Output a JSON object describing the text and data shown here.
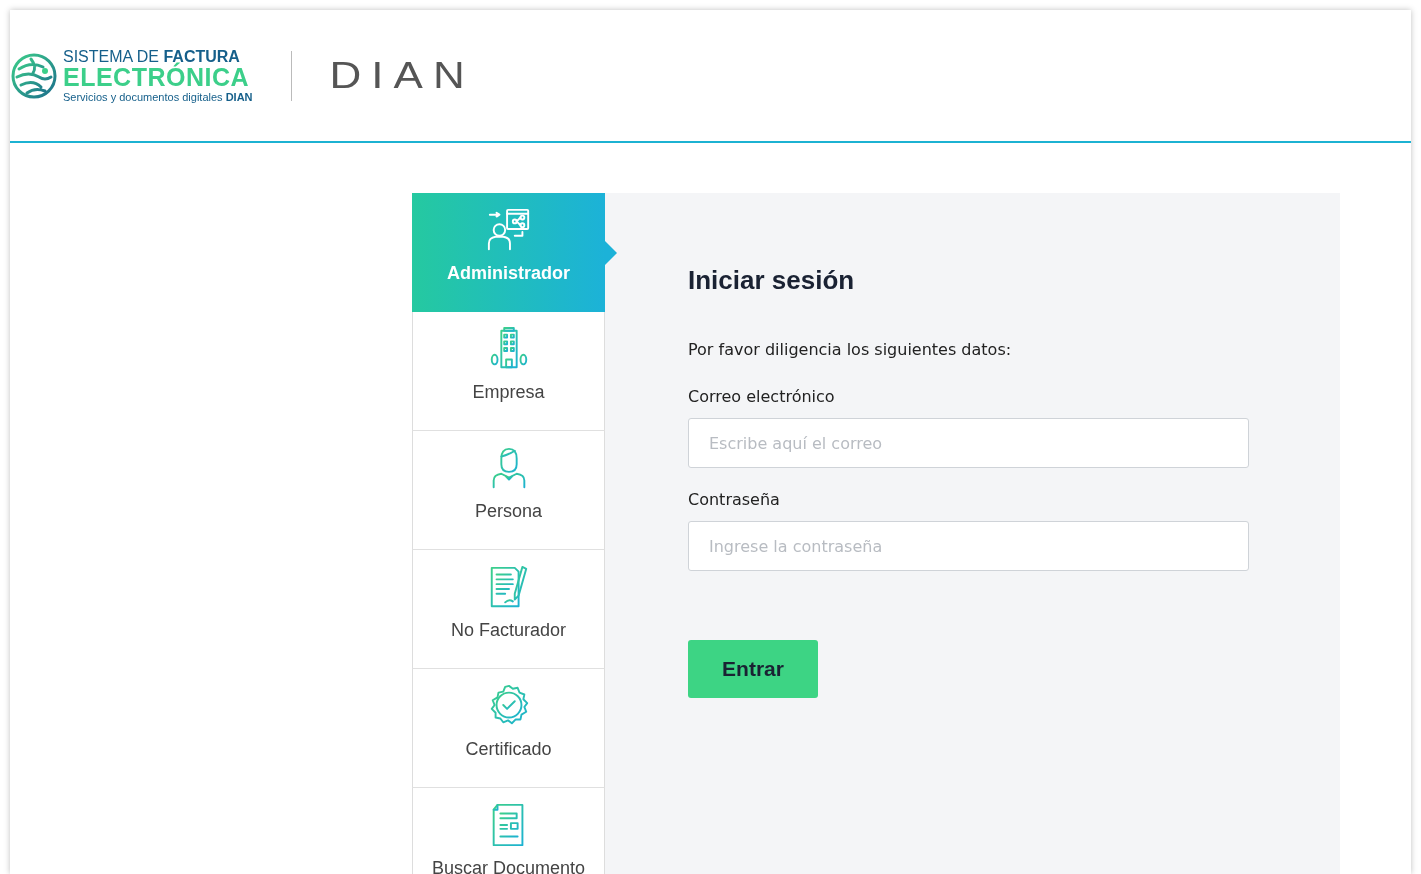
{
  "header": {
    "logo_line1": "SISTEMA DE **FACTURA**",
    "logo_line2": "ELECTRÓNICA",
    "logo_line3": "Servicios y documentos digitales **DIAN**",
    "brand": "DIAN"
  },
  "tabs": [
    {
      "label": "Administrador",
      "kind": "admin",
      "selected": true
    },
    {
      "label": "Empresa",
      "kind": "building",
      "selected": false
    },
    {
      "label": "Persona",
      "kind": "person",
      "selected": false
    },
    {
      "label": "No Facturador",
      "kind": "document-pen",
      "selected": false
    },
    {
      "label": "Certificado",
      "kind": "certificate",
      "selected": false
    },
    {
      "label": "Buscar Documento",
      "kind": "document",
      "selected": false
    }
  ],
  "login": {
    "title": "Iniciar sesión",
    "intro": "Por favor diligencia los siguientes datos:",
    "fields": [
      {
        "label": "Correo electrónico",
        "placeholder": "Escribe aquí el correo"
      },
      {
        "label": "Contraseña",
        "placeholder": "Ingrese la contraseña"
      }
    ],
    "button": "Entrar"
  }
}
